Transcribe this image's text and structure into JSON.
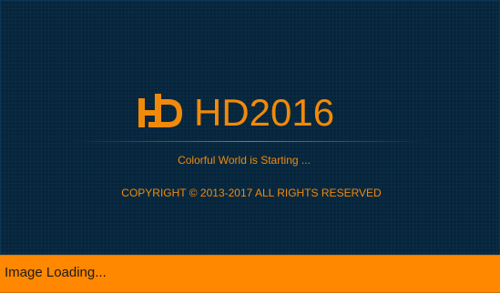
{
  "splash": {
    "brand_name": "HD2016",
    "logo_icon": "hd-logo-icon",
    "tagline": "Colorful World is Starting ...",
    "copyright": "COPYRIGHT © 2013-2017 ALL RIGHTS RESERVED"
  },
  "status_bar": {
    "message": "Image Loading..."
  },
  "colors": {
    "background": "#05253c",
    "accent": "#f18a0a",
    "status_bar": "#ff8800"
  }
}
